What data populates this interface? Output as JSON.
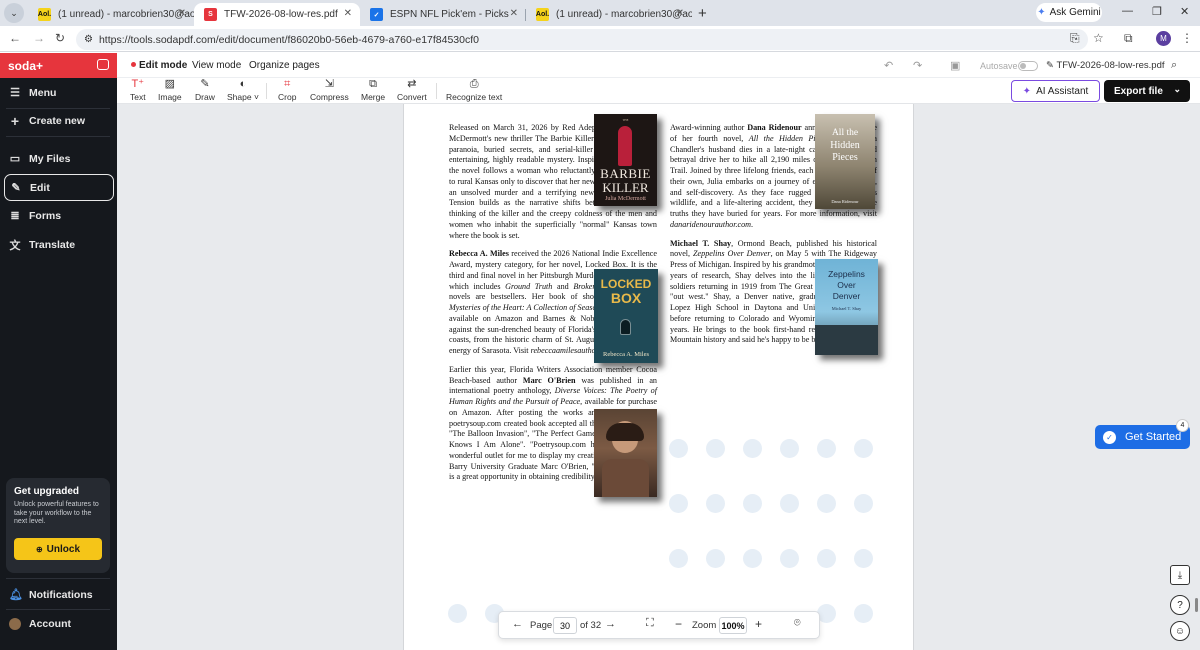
{
  "browser": {
    "tabs": [
      {
        "title": "(1 unread) - marcobrien30@ao",
        "icon": "aol-icon",
        "favicon_text": "Aol."
      },
      {
        "title": "TFW-2026-08-low-res.pdf",
        "icon": "sodapdf-icon",
        "favicon_text": "S",
        "active": true
      },
      {
        "title": "ESPN NFL Pick'em - Picks",
        "icon": "checkbox-icon"
      },
      {
        "title": "(1 unread) - marcobrien30@ao",
        "icon": "aol-icon",
        "favicon_text": "Aol."
      }
    ],
    "ask_gemini": "Ask Gemini",
    "url": "https://tools.sodapdf.com/edit/document/f86020b0-56eb-4679-a760-e17f84530cf0",
    "profile_initial": "M"
  },
  "sidebar": {
    "brand": "soda+",
    "items": [
      {
        "label": "Menu",
        "icon": "hamburger-icon"
      },
      {
        "label": "Create new",
        "icon": "plus-icon"
      },
      {
        "label": "My Files",
        "icon": "folder-icon"
      },
      {
        "label": "Edit",
        "icon": "pencil-icon",
        "selected": true
      },
      {
        "label": "Forms",
        "icon": "forms-icon"
      },
      {
        "label": "Translate",
        "icon": "translate-icon"
      }
    ],
    "upgrade": {
      "title": "Get upgraded",
      "text": "Unlock powerful features to take your workflow to the next level.",
      "button": "Unlock"
    },
    "notifications": "Notifications",
    "account": "Account"
  },
  "modes": {
    "items": [
      "Edit mode",
      "View mode",
      "Organize pages"
    ],
    "active": "Edit mode",
    "autosave": "Autosave",
    "filename": "TFW-2026-08-low-res.pdf"
  },
  "toolbar": {
    "tools": [
      {
        "label": "Text",
        "icon": "text-plus-icon"
      },
      {
        "label": "Image",
        "icon": "image-icon"
      },
      {
        "label": "Draw",
        "icon": "draw-icon"
      },
      {
        "label": "Shape",
        "icon": "shape-icon"
      },
      {
        "label": "Crop",
        "icon": "crop-icon"
      },
      {
        "label": "Compress",
        "icon": "compress-icon"
      },
      {
        "label": "Merge",
        "icon": "merge-icon"
      },
      {
        "label": "Convert",
        "icon": "convert-icon"
      },
      {
        "label": "Recognize text",
        "icon": "ocr-icon"
      }
    ],
    "ai_assistant": "AI Assistant",
    "export_file": "Export file"
  },
  "document": {
    "left": {
      "p1": "Released on March 31, 2026 by Red Adept Publishing, Julia McDermott's new thriller The Barbie Killer blends small-town paranoia, buried secrets, and serial-killer suspense into an entertaining, highly readable mystery. Inspired by true events, the novel follows a woman who reluctantly moves her family to rural Kansas only to discover that her new town harbors both an unsolved murder and a terrifying new wave of killings. Tension builds as the narrative shifts between the tortured thinking of the killer and the creepy coldness of the men and women who inhabit the superficially \"normal\" Kansas town where the book is set.",
      "p2a": "Rebecca A. Miles",
      "p2b": " received the 2026 National Indie Excellence Award, mystery category, for her novel, Locked Box. It is the third and final novel in her Pittsburgh Murder Mystery Trilogy, which includes ",
      "p2c": "Ground Truth",
      "p2d": " and ",
      "p2e": "Broken Glass",
      "p2f": ". All three novels are bestsellers. Her book of short stories entitled, ",
      "p2g": "Mysteries of the Heart: A Collection of Seasonal Stories",
      "p2h": ", is now available on Amazon and Barnes & Noble. Stories are set against the sun-drenched beauty of Florida's Gulf and Atlantic coasts, from the historic charm of St. Augustine to the vibrant energy of Sarasota. Visit ",
      "p2i": "rebeccaamilesauthor.com",
      "p2j": ".",
      "p3a": "Earlier this year, Florida Writers Association member Cocoa Beach-based author ",
      "p3b": "Marc O'Brien",
      "p3c": " was published in an international poetry anthology, ",
      "p3d": "Diverse Voices: The Poetry of Human Rights and the Pursuit of Peace",
      "p3e": ", available for purchase on Amazon. After posting the works and submitting, the poetrysoup.com created book accepted all three. Titles include, \"The Balloon Invasion\", \"The Perfect Game\", and \"The Drone Knows I Am Alone\". \"Poetrysoup.com has always been a wonderful outlet for me to display my creative messages,\" said Barry University Graduate Marc O'Brien, \"and this anthology is a great opportunity in obtaining credibility.\""
    },
    "right": {
      "p1a": "Award-winning author ",
      "p1b": "Dana Ridenour",
      "p1c": " announces the release of her fourth novel, ",
      "p1d": "All the Hidden Pieces",
      "p1e": ". When Julia Chandler's husband dies in a late-night car crash, grief and betrayal drive her to hike all 2,190 miles of the Appalachian Trail. Joined by three lifelong friends, each carrying secrets of their own, Julia embarks on a journey of endurance, healing, and self-discovery. As they face rugged terrain, dangerous wildlife, and a life-altering accident, they must confront the truths they have buried for years. For more information, visit ",
      "p1f": "danaridenourauthor.com",
      "p1g": ".",
      "p2a": "Michael T. Shay",
      "p2b": ", Ormond Beach, published his historical novel, ",
      "p2c": "Zeppelins Over Denver",
      "p2d": ", on May 5 with The Ridgeway Press of Michigan. Inspired by his grandmother's war diary and years of research, Shay delves into the lives of nurses and soldiers returning in 1919 from The Great War for new lives \"out west.\" Shay, a Denver native, graduated from Father Lopez High School in Daytona and University of Florida before returning to Colorado and Wyoming to work for 46 years. He brings to the book first-hand research into Rocky Mountain history and said he's happy to be back in Florida."
    },
    "covers": {
      "barbie": {
        "line1": "THE",
        "line2": "BARBIE",
        "line3": "KILLER",
        "author": "Julia McDermott"
      },
      "hidden": {
        "line1": "All the",
        "line2": "Hidden",
        "line3": "Pieces",
        "author": "Dana Ridenour"
      },
      "locked": {
        "line1": "LOCKED",
        "line2": "BOX",
        "author": "Rebecca A. Miles"
      },
      "zeppelins": {
        "line1": "Zeppelins",
        "line2": "Over",
        "line3": "Denver",
        "author": "Michael T. Shay"
      }
    }
  },
  "pager": {
    "page_label": "Page",
    "current_page": "30",
    "of_total": "of 32",
    "zoom_label": "Zoom",
    "zoom_value": "100%"
  },
  "get_started": {
    "label": "Get Started",
    "badge": "4"
  }
}
